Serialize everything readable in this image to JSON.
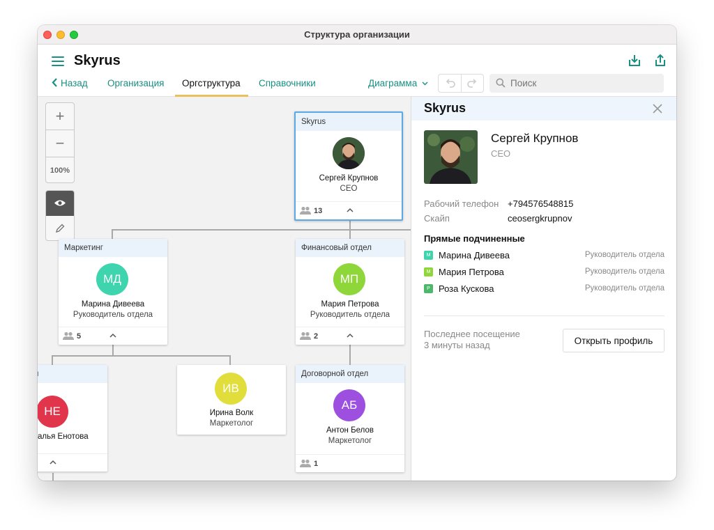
{
  "window": {
    "title": "Структура организации"
  },
  "header": {
    "app_name": "Skyrus",
    "back_label": "Назад",
    "tabs": [
      {
        "label": "Организация"
      },
      {
        "label": "Оргструктура",
        "active": true
      },
      {
        "label": "Справочники"
      }
    ],
    "view_dropdown": "Диаграмма",
    "search_placeholder": "Поиск"
  },
  "zoom": {
    "plus": "+",
    "minus": "−",
    "level": "100%"
  },
  "org_cards": [
    {
      "dept": "Skyrus",
      "name": "Сергей Крупнов",
      "role": "CEO",
      "count": "13",
      "avatar": "photo",
      "selected": true
    },
    {
      "dept": "Маркетинг",
      "initials": "МД",
      "name": "Марина Дивеева",
      "role": "Руководитель отдела",
      "count": "5",
      "avatar_color": "#3ed4ad"
    },
    {
      "dept": "Финансовый отдел",
      "initials": "МП",
      "name": "Мария Петрова",
      "role": "Руководитель отдела",
      "count": "2",
      "avatar_color": "#8ed63a"
    },
    {
      "dept": "",
      "initials": "НЕ",
      "name": "алья Енотова",
      "role": "",
      "count": "",
      "avatar_color": "#e0354b"
    },
    {
      "dept": "",
      "initials": "ИВ",
      "name": "Ирина Волк",
      "role": "Маркетолог",
      "count": "",
      "avatar_color": "#e1de3c"
    },
    {
      "dept": "Договорной отдел",
      "initials": "АБ",
      "name": "Антон Белов",
      "role": "Маркетолог",
      "count": "1",
      "avatar_color": "#9d4fe0"
    }
  ],
  "panel": {
    "title": "Skyrus",
    "name": "Сергей Крупнов",
    "role": "CEO",
    "phone_label": "Рабочий телефон",
    "phone_value": "+794576548815",
    "skype_label": "Скайп",
    "skype_value": "ceosergkrupnov",
    "subordinates_title": "Прямые подчиненные",
    "subordinates": [
      {
        "badge": "М",
        "badge_color": "#3ed4ad",
        "name": "Марина Дивеева",
        "role": "Руководитель отдела"
      },
      {
        "badge": "М",
        "badge_color": "#8ed63a",
        "name": "Мария Петрова",
        "role": "Руководитель отдела"
      },
      {
        "badge": "Р",
        "badge_color": "#4cb96a",
        "name": "Роза Кускова",
        "role": "Руководитель отдела"
      }
    ],
    "last_visit_label": "Последнее посещение",
    "last_visit_value": "3 минуты назад",
    "open_profile_label": "Открыть профиль"
  },
  "colors": {
    "accent": "#1a8f83",
    "tab_underline": "#e8c15a",
    "selection": "#5aa9e6"
  }
}
